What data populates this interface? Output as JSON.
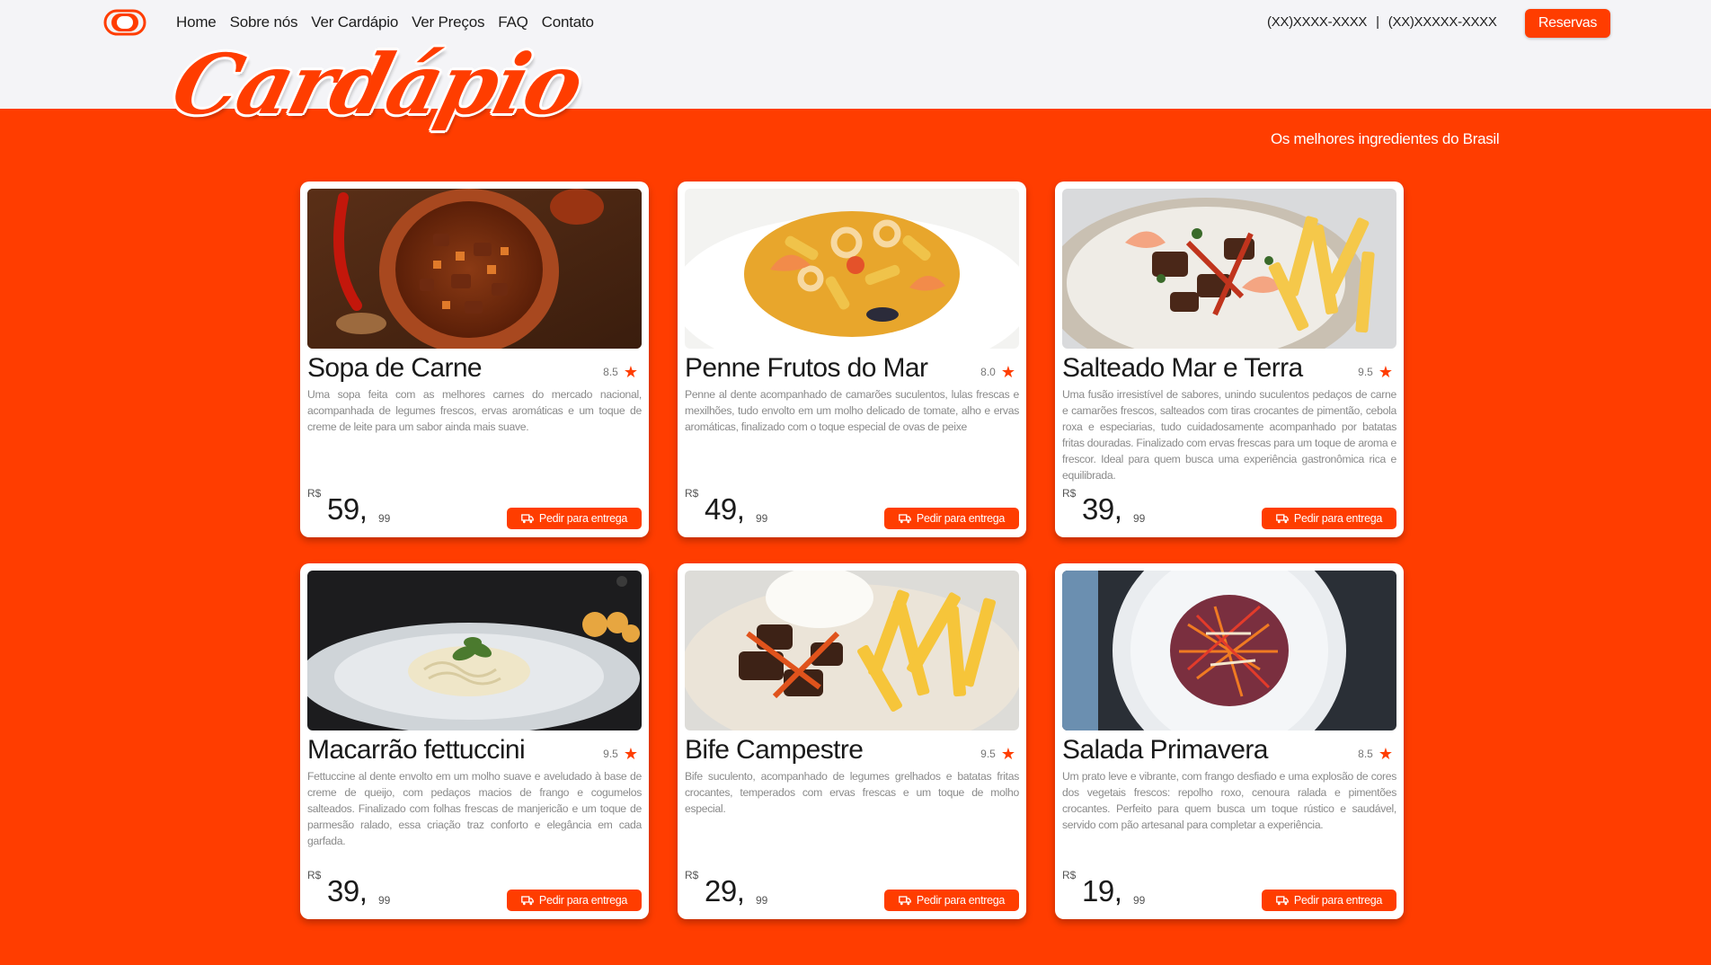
{
  "nav": {
    "links": [
      "Home",
      "Sobre nós",
      "Ver Cardápio",
      "Ver Preços",
      "FAQ",
      "Contato"
    ],
    "phone_1": "(XX)XXXX-XXXX",
    "phone_sep": "|",
    "phone_2": "(XX)XXXXX-XXXX",
    "reserve_label": "Reservas"
  },
  "hero": {
    "title": "Cardápio",
    "subtitle": "Os melhores ingredientes do Brasil"
  },
  "colors": {
    "accent": "#ff3d00",
    "header_bg": "#f4f4f7"
  },
  "menu": [
    {
      "title": "Sopa de Carne",
      "rating": "8.5",
      "description": "Uma sopa feita com as melhores carnes do mercado nacional, acompanhada de legumes frescos, ervas aromáticas e um toque de creme de leite para um sabor ainda mais suave.",
      "currency": "R$",
      "price_int": "59,",
      "price_cents": "99",
      "order_label": "Pedir para entrega"
    },
    {
      "title": "Penne Frutos do Mar",
      "rating": "8.0",
      "description": "Penne al dente acompanhado de camarões suculentos, lulas frescas e mexilhões, tudo envolto em um molho delicado de tomate, alho e ervas aromáticas, finalizado com o toque especial de ovas de peixe",
      "currency": "R$",
      "price_int": "49,",
      "price_cents": "99",
      "order_label": "Pedir para entrega"
    },
    {
      "title": "Salteado Mar e Terra",
      "rating": "9.5",
      "description": "Uma fusão irresistível de sabores, unindo suculentos pedaços de carne e camarões frescos, salteados com tiras crocantes de pimentão, cebola roxa e especiarias, tudo cuidadosamente acompanhado por batatas fritas douradas. Finalizado com ervas frescas para um toque de aroma e frescor. Ideal para quem busca uma experiência gastronômica rica e equilibrada.",
      "currency": "R$",
      "price_int": "39,",
      "price_cents": "99",
      "order_label": "Pedir para entrega"
    },
    {
      "title": "Macarrão fettuccini",
      "rating": "9.5",
      "description": "Fettuccine al dente envolto em um molho suave e aveludado à base de creme de queijo, com pedaços macios de frango e cogumelos salteados. Finalizado com folhas frescas de manjericão e um toque de parmesão ralado, essa criação traz conforto e elegância em cada garfada.",
      "currency": "R$",
      "price_int": "39,",
      "price_cents": "99",
      "order_label": "Pedir para entrega"
    },
    {
      "title": "Bife Campestre",
      "rating": "9.5",
      "description": "Bife suculento, acompanhado de legumes grelhados e batatas fritas crocantes, temperados com ervas frescas e um toque de molho especial.",
      "currency": "R$",
      "price_int": "29,",
      "price_cents": "99",
      "order_label": "Pedir para entrega"
    },
    {
      "title": "Salada Primavera",
      "rating": "8.5",
      "description": "Um prato leve e vibrante, com frango desfiado e uma explosão de cores dos vegetais frescos: repolho roxo, cenoura ralada e pimentões crocantes. Perfeito para quem busca um toque rústico e saudável, servido com pão artesanal para completar a experiência.",
      "currency": "R$",
      "price_int": "19,",
      "price_cents": "99",
      "order_label": "Pedir para entrega"
    }
  ]
}
